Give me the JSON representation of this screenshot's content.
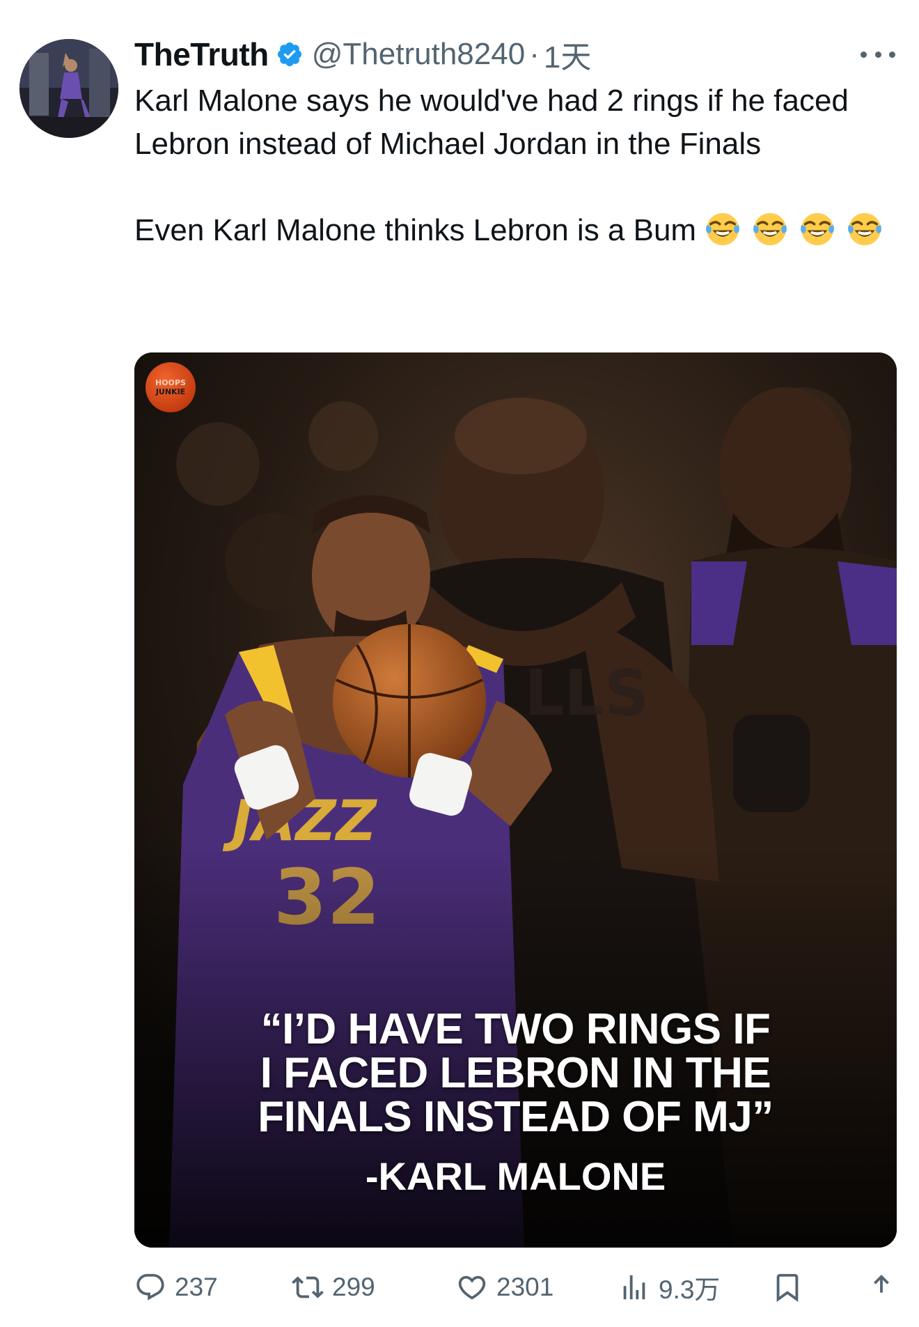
{
  "tweet": {
    "display_name": "TheTruth",
    "handle": "@Thetruth8240",
    "separator": "·",
    "time": "1天",
    "text_line1": "Karl Malone says he would've had 2 rings if he faced Lebron instead of Michael Jordan in the Finals",
    "text_line2": "Even Karl Malone thinks Lebron is a Bum",
    "emoji_count": 4
  },
  "media": {
    "logo_text_top": "HOOPS",
    "logo_text_bottom": "JUNKIE",
    "quote_line1": "“I’D HAVE TWO RINGS IF",
    "quote_line2": "I FACED LEBRON IN THE",
    "quote_line3": "FINALS INSTEAD OF MJ”",
    "attribution": "-KARL MALONE"
  },
  "actions": {
    "replies": "237",
    "retweets": "299",
    "likes": "2301",
    "views": "9.3万"
  },
  "colors": {
    "text": "#0f1419",
    "secondary": "#536471",
    "verified": "#1d9bf0",
    "jazz_purple": "#4b2e7a",
    "lakers_gold": "#f2c12e"
  }
}
